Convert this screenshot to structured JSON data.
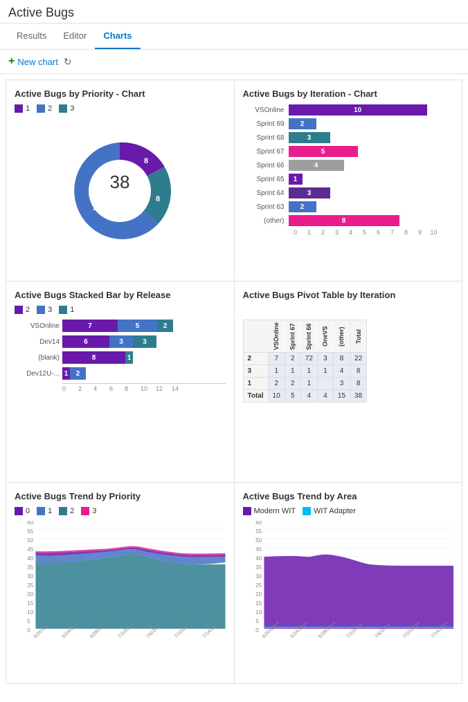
{
  "page": {
    "title": "Active Bugs",
    "tabs": [
      {
        "label": "Results",
        "active": false
      },
      {
        "label": "Editor",
        "active": false
      },
      {
        "label": "Charts",
        "active": true
      }
    ],
    "toolbar": {
      "new_chart": "New chart",
      "refresh_icon": "↻"
    }
  },
  "charts": {
    "priority_chart": {
      "title": "Active Bugs by Priority - Chart",
      "legend": [
        {
          "label": "1",
          "color": "#6a1aab"
        },
        {
          "label": "2",
          "color": "#4472c4"
        },
        {
          "label": "3",
          "color": "#2e7d8e"
        }
      ],
      "total": "38",
      "segments": [
        {
          "label": "1",
          "value": 8,
          "color": "#6a1aab",
          "percent": 21
        },
        {
          "label": "2",
          "value": 22,
          "color": "#4472c4",
          "percent": 58
        },
        {
          "label": "3",
          "value": 8,
          "color": "#2e7d8e",
          "percent": 21
        }
      ]
    },
    "iteration_chart": {
      "title": "Active Bugs by Iteration - Chart",
      "bars": [
        {
          "label": "VSOnline",
          "value": 10,
          "color": "#6a1aab"
        },
        {
          "label": "Sprint 69",
          "value": 2,
          "color": "#4472c4"
        },
        {
          "label": "Sprint 68",
          "value": 3,
          "color": "#2e7d8e"
        },
        {
          "label": "Sprint 67",
          "value": 5,
          "color": "#e91e8c"
        },
        {
          "label": "Sprint 66",
          "value": 4,
          "color": "#9e9e9e"
        },
        {
          "label": "Sprint 65",
          "value": 1,
          "color": "#6a1aab"
        },
        {
          "label": "Sprint 64",
          "value": 3,
          "color": "#5c2d91"
        },
        {
          "label": "Sprint 63",
          "value": 2,
          "color": "#4472c4"
        },
        {
          "label": "(other)",
          "value": 8,
          "color": "#e91e8c"
        }
      ],
      "max": 10,
      "axis": [
        0,
        1,
        2,
        3,
        4,
        5,
        6,
        7,
        8,
        9,
        10
      ]
    },
    "stacked_bar_chart": {
      "title": "Active Bugs Stacked Bar by Release",
      "legend": [
        {
          "label": "2",
          "color": "#6a1aab"
        },
        {
          "label": "3",
          "color": "#4472c4"
        },
        {
          "label": "1",
          "color": "#2e7d8e"
        }
      ],
      "rows": [
        {
          "label": "VSOnline",
          "segments": [
            {
              "value": 7,
              "color": "#6a1aab"
            },
            {
              "value": 5,
              "color": "#4472c4"
            },
            {
              "value": 2,
              "color": "#2e7d8e"
            }
          ]
        },
        {
          "label": "Dev14",
          "segments": [
            {
              "value": 6,
              "color": "#6a1aab"
            },
            {
              "value": 3,
              "color": "#4472c4"
            },
            {
              "value": 3,
              "color": "#2e7d8e"
            }
          ]
        },
        {
          "label": "(blank)",
          "segments": [
            {
              "value": 8,
              "color": "#6a1aab"
            },
            {
              "value": 0,
              "color": "#4472c4"
            },
            {
              "value": 1,
              "color": "#2e7d8e"
            }
          ]
        },
        {
          "label": "Dev12U-...",
          "segments": [
            {
              "value": 1,
              "color": "#6a1aab"
            },
            {
              "value": 2,
              "color": "#4472c4"
            },
            {
              "value": 0,
              "color": "#2e7d8e"
            }
          ]
        }
      ],
      "max": 14,
      "axis": [
        0,
        2,
        4,
        6,
        8,
        10,
        12,
        14
      ]
    },
    "pivot_table": {
      "title": "Active Bugs Pivot Table by Iteration",
      "col_headers": [
        "VSOnline",
        "Sprint 67",
        "Sprint 66",
        "OneVS",
        "(other)",
        "Total"
      ],
      "rows": [
        {
          "header": "2",
          "values": [
            "7",
            "2",
            "72",
            "3",
            "8",
            "22"
          ]
        },
        {
          "header": "3",
          "values": [
            "1",
            "1",
            "1",
            "1",
            "4",
            "8"
          ]
        },
        {
          "header": "1",
          "values": [
            "2",
            "2",
            "1",
            "",
            "3",
            "8"
          ]
        },
        {
          "header": "Total",
          "values": [
            "10",
            "5",
            "4",
            "4",
            "15",
            "38"
          ]
        }
      ]
    },
    "trend_priority": {
      "title": "Active Bugs Trend by Priority",
      "legend": [
        {
          "label": "0",
          "color": "#6a1aab"
        },
        {
          "label": "1",
          "color": "#4472c4"
        },
        {
          "label": "2",
          "color": "#2e7d8e"
        },
        {
          "label": "3",
          "color": "#e91e8c"
        }
      ],
      "y_axis": [
        60,
        55,
        50,
        45,
        40,
        35,
        30,
        25,
        20,
        15,
        10,
        5,
        0
      ],
      "x_axis": [
        "6/20/2014",
        "6/24/2014",
        "6/28/2014",
        "7/2/2014",
        "7/6/2014",
        "7/10/2014",
        "7/14/2014"
      ]
    },
    "trend_area": {
      "title": "Active Bugs Trend by Area",
      "legend": [
        {
          "label": "Modern WIT",
          "color": "#6a1aab"
        },
        {
          "label": "WIT Adapter",
          "color": "#00bcf2"
        }
      ],
      "y_axis": [
        60,
        55,
        50,
        45,
        40,
        35,
        30,
        25,
        20,
        15,
        10,
        5,
        0
      ],
      "x_axis": [
        "6/20/2014",
        "6/24/2014",
        "6/28/2014",
        "7/2/2014",
        "7/6/2014",
        "7/10/2014",
        "7/14/2014"
      ]
    }
  }
}
